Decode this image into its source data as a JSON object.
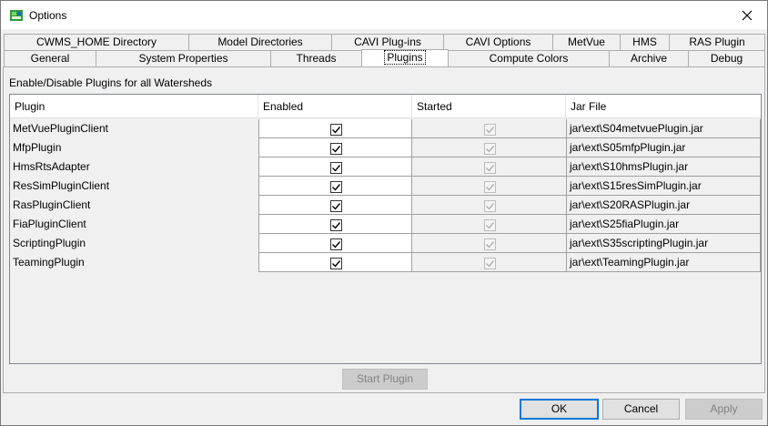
{
  "window": {
    "title": "Options"
  },
  "tabs_row1": [
    "CWMS_HOME Directory",
    "Model Directories",
    "CAVI Plug-ins",
    "CAVI Options",
    "MetVue",
    "HMS",
    "RAS Plugin"
  ],
  "tabs_row2": [
    "General",
    "System Properties",
    "Threads",
    "Plugins",
    "Compute Colors",
    "Archive",
    "Debug"
  ],
  "selected_tab": "Plugins",
  "panel": {
    "section_label": "Enable/Disable Plugins for all Watersheds",
    "columns": [
      "Plugin",
      "Enabled",
      "Started",
      "Jar File"
    ],
    "rows": [
      {
        "plugin": "MetVuePluginClient",
        "enabled": true,
        "started": true,
        "jar": "jar\\ext\\S04metvuePlugin.jar"
      },
      {
        "plugin": "MfpPlugin",
        "enabled": true,
        "started": true,
        "jar": "jar\\ext\\S05mfpPlugin.jar"
      },
      {
        "plugin": "HmsRtsAdapter",
        "enabled": true,
        "started": true,
        "jar": "jar\\ext\\S10hmsPlugin.jar"
      },
      {
        "plugin": "ResSimPluginClient",
        "enabled": true,
        "started": true,
        "jar": "jar\\ext\\S15resSimPlugin.jar"
      },
      {
        "plugin": "RasPluginClient",
        "enabled": true,
        "started": true,
        "jar": "jar\\ext\\S20RASPlugin.jar"
      },
      {
        "plugin": "FiaPluginClient",
        "enabled": true,
        "started": true,
        "jar": "jar\\ext\\S25fiaPlugin.jar"
      },
      {
        "plugin": "ScriptingPlugin",
        "enabled": true,
        "started": true,
        "jar": "jar\\ext\\S35scriptingPlugin.jar"
      },
      {
        "plugin": "TeamingPlugin",
        "enabled": true,
        "started": true,
        "jar": "jar\\ext\\TeamingPlugin.jar"
      }
    ],
    "start_plugin_label": "Start Plugin"
  },
  "footer": {
    "ok_label": "OK",
    "cancel_label": "Cancel",
    "apply_label": "Apply"
  },
  "colors": {
    "accent": "#0078d7",
    "disabled_text": "#838383"
  }
}
